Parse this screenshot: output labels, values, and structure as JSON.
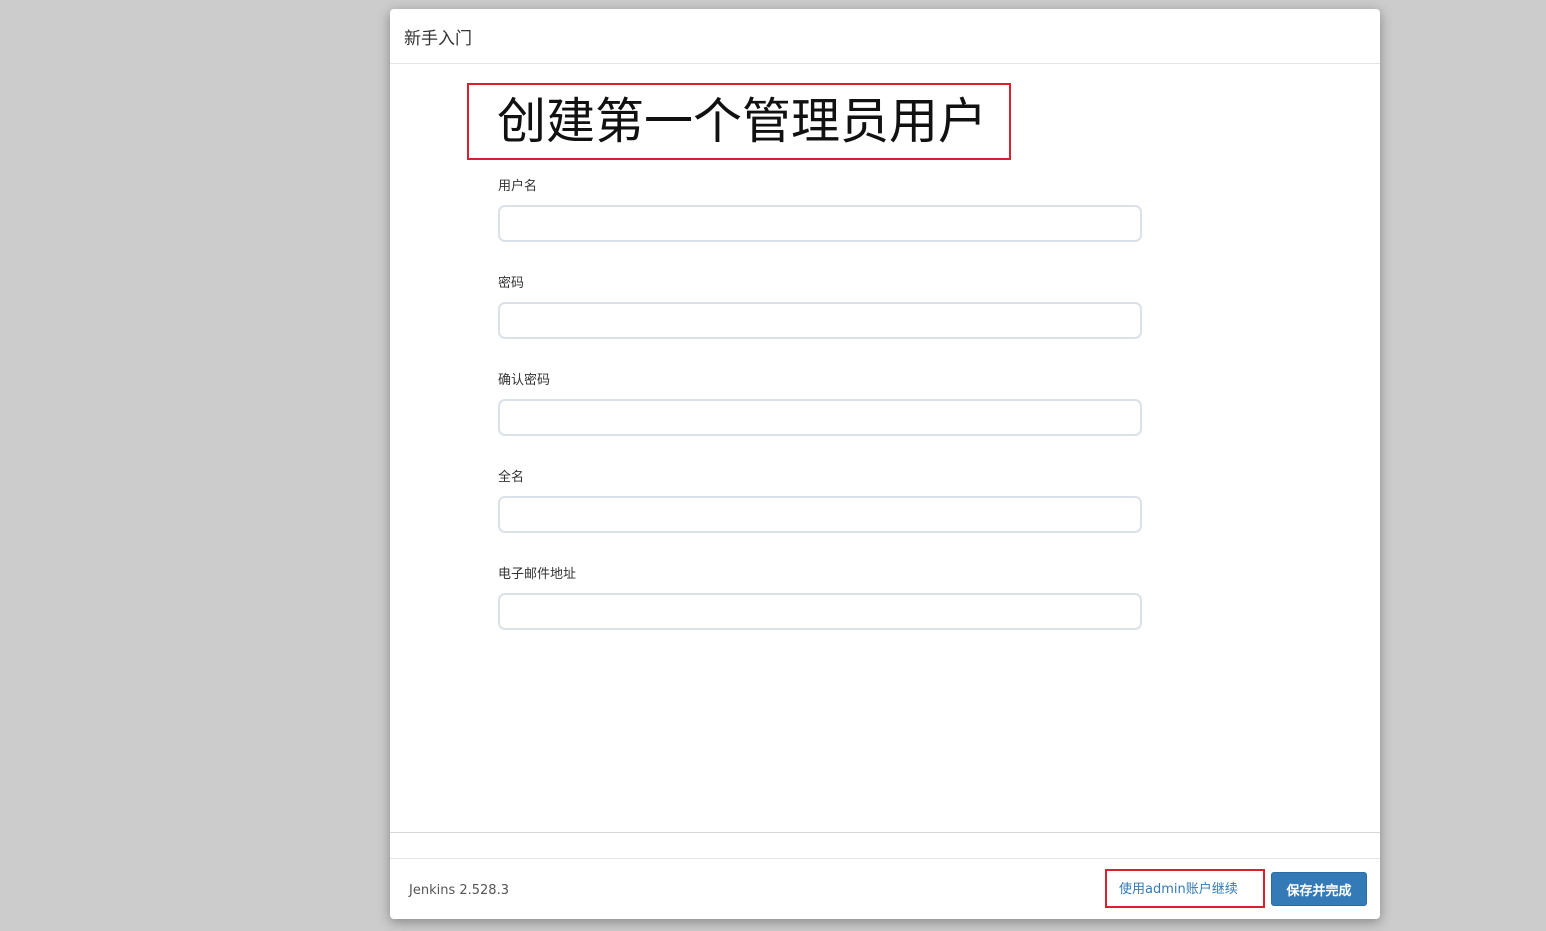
{
  "dialog": {
    "title": "新手入门",
    "heading": "创建第一个管理员用户"
  },
  "form": {
    "fields": [
      {
        "label": "用户名",
        "value": "",
        "type": "text"
      },
      {
        "label": "密码",
        "value": "",
        "type": "password"
      },
      {
        "label": "确认密码",
        "value": "",
        "type": "password"
      },
      {
        "label": "全名",
        "value": "",
        "type": "text"
      },
      {
        "label": "电子邮件地址",
        "value": "",
        "type": "text"
      }
    ]
  },
  "footer": {
    "version": "Jenkins 2.528.3",
    "continue_as_admin_label": "使用admin账户继续",
    "save_finish_label": "保存并完成"
  },
  "colors": {
    "highlight": "#d9202f",
    "primary": "#337ab7",
    "backdrop": "#cccccc"
  }
}
